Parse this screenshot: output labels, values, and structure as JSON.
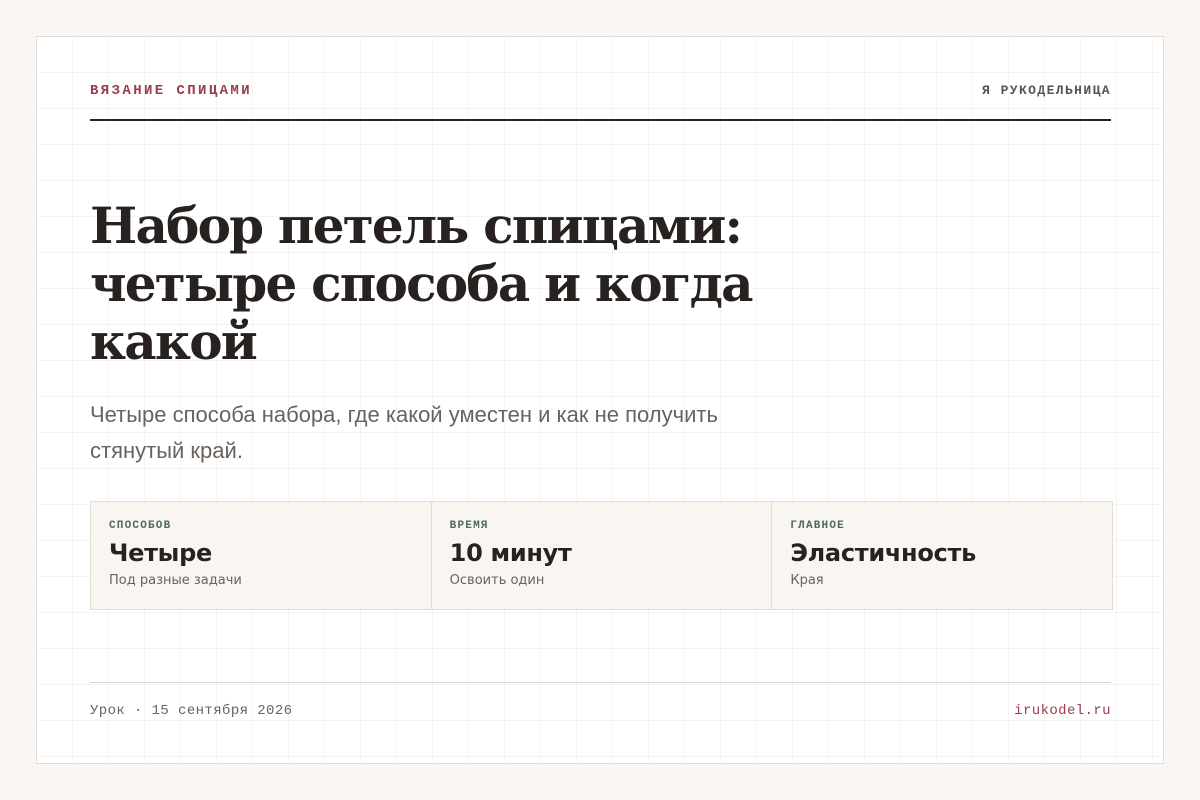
{
  "header": {
    "topic": "ВЯЗАНИЕ СПИЦАМИ",
    "brand": "Я РУКОДЕЛЬНИЦА"
  },
  "article": {
    "title": "Набор петель спицами: четыре способа и когда какой",
    "subtitle": "Четыре способа набора, где какой уместен и как не получить стянутый край."
  },
  "stats": [
    {
      "label": "СПОСОБОВ",
      "value": "Четыре",
      "note": "Под разные задачи"
    },
    {
      "label": "ВРЕМЯ",
      "value": "10 минут",
      "note": "Освоить один"
    },
    {
      "label": "ГЛАВНОЕ",
      "value": "Эластичность",
      "note": "Края"
    }
  ],
  "footer": {
    "meta": "Урок · 15 сентября 2026",
    "site": "irukodel.ru"
  },
  "colors": {
    "accent": "#9a3d4c",
    "label_green": "#4d6b58",
    "text": "#272220",
    "page_bg": "#faf6f3"
  }
}
